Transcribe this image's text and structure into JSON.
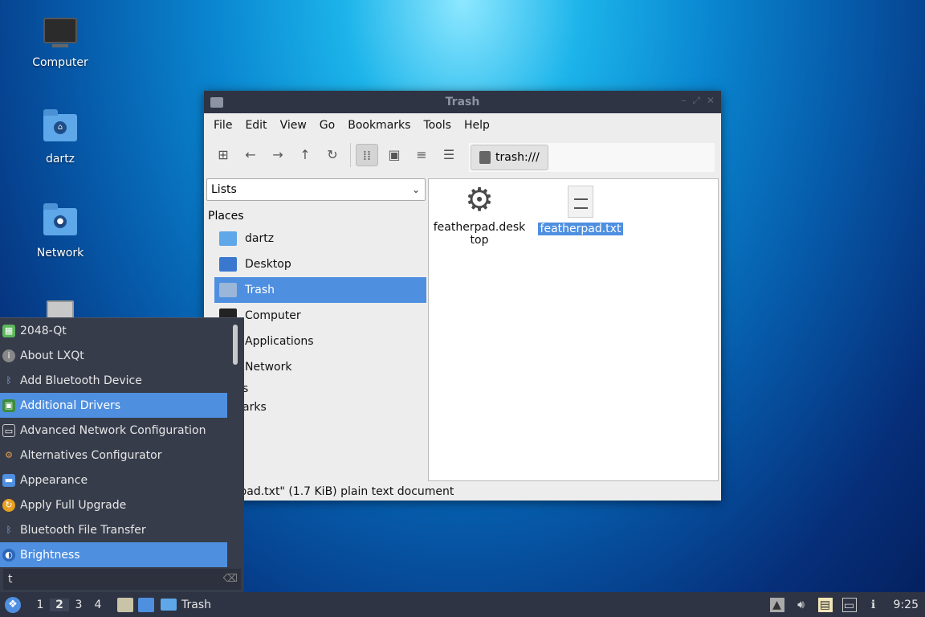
{
  "desktop": {
    "icons": [
      {
        "label": "Computer"
      },
      {
        "label": "dartz"
      },
      {
        "label": "Network"
      }
    ]
  },
  "window": {
    "title": "Trash",
    "menu": [
      "File",
      "Edit",
      "View",
      "Go",
      "Bookmarks",
      "Tools",
      "Help"
    ],
    "location": "trash:///",
    "side_select": "Lists",
    "places_heading": "Places",
    "places": [
      {
        "label": "dartz"
      },
      {
        "label": "Desktop"
      },
      {
        "label": "Trash"
      },
      {
        "label": "Computer"
      },
      {
        "label": "Applications"
      },
      {
        "label": "Network"
      }
    ],
    "places_extra": [
      "s",
      "arks"
    ],
    "files": [
      {
        "name": "featherpad.desktop",
        "line1": "featherpad.desk",
        "line2": "top"
      },
      {
        "name": "featherpad.txt"
      }
    ],
    "status": "erpad.txt\" (1.7 KiB) plain text document"
  },
  "app_menu": {
    "items": [
      {
        "label": "2048-Qt",
        "icon": "2048-icon",
        "color": "#5cb85c"
      },
      {
        "label": "About LXQt",
        "icon": "info-icon",
        "color": "#888888"
      },
      {
        "label": "Add Bluetooth Device",
        "icon": "bluetooth-icon",
        "color": "#4f8fe0"
      },
      {
        "label": "Additional Drivers",
        "icon": "chip-icon",
        "color": "#3c8c3c"
      },
      {
        "label": "Advanced Network Configuration",
        "icon": "network-icon",
        "color": "#cccccc"
      },
      {
        "label": "Alternatives Configurator",
        "icon": "alternatives-icon",
        "color": "#aa7a3a"
      },
      {
        "label": "Appearance",
        "icon": "appearance-icon",
        "color": "#4f8fe0"
      },
      {
        "label": "Apply Full Upgrade",
        "icon": "upgrade-icon",
        "color": "#e8a020"
      },
      {
        "label": "Bluetooth File Transfer",
        "icon": "bluetooth-icon",
        "color": "#4f8fe0"
      },
      {
        "label": "Brightness",
        "icon": "brightness-icon",
        "color": "#3d7bd6"
      }
    ],
    "search_value": "t"
  },
  "taskbar": {
    "workspaces": [
      "1",
      "2",
      "3",
      "4"
    ],
    "current_workspace": "2",
    "task_label": "Trash",
    "clock": "9:25"
  },
  "colors": {
    "selection": "#4f8fe0",
    "panel": "#2e3444"
  }
}
